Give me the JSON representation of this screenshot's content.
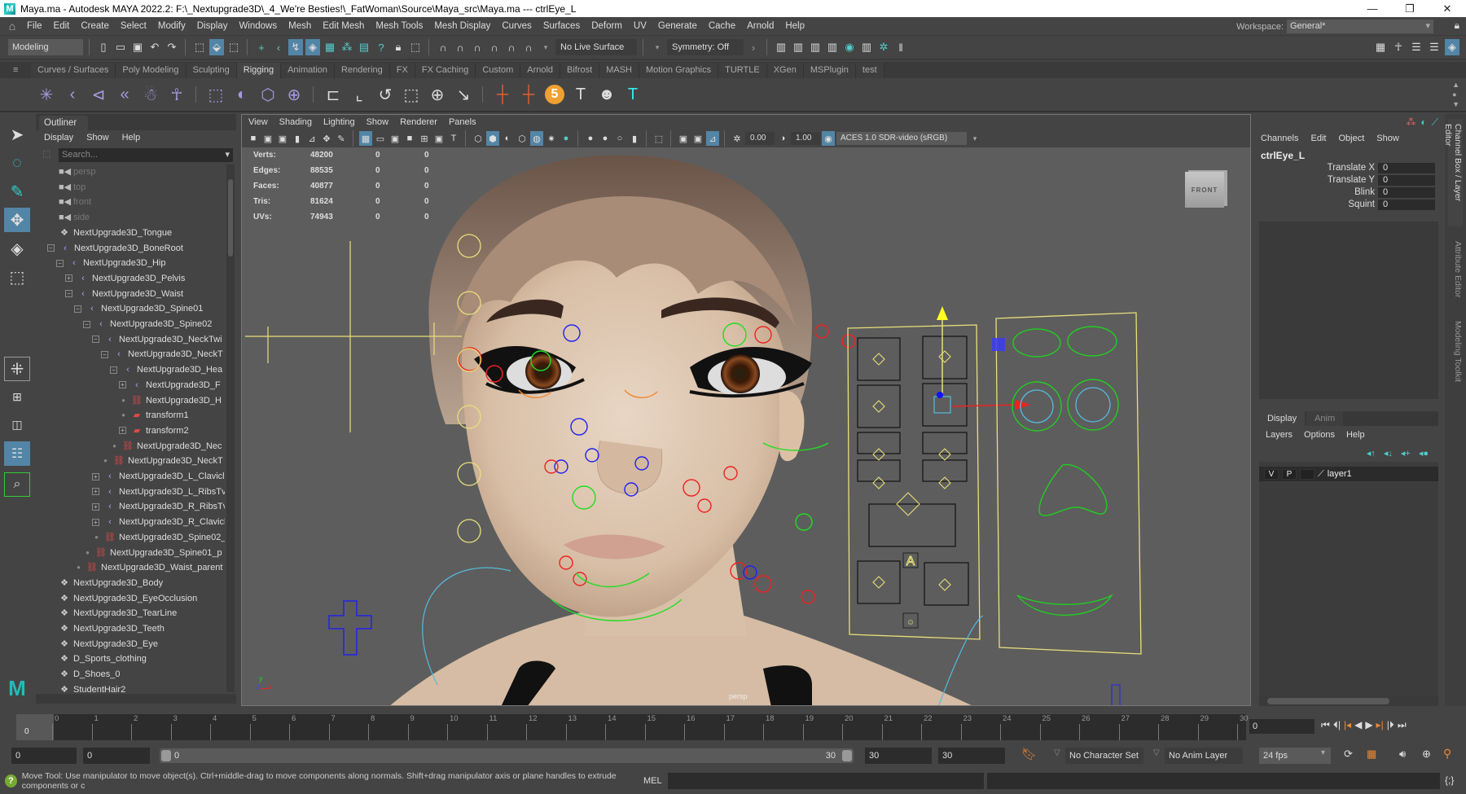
{
  "window": {
    "title": "Maya.ma - Autodesk MAYA 2022.2: F:\\_Nextupgrade3D\\_4_We're Besties!\\_FatWoman\\Source\\Maya_src\\Maya.ma  ---  ctrlEye_L",
    "minimize": "—",
    "restore": "❐",
    "close": "✕"
  },
  "menubar": {
    "items": [
      "File",
      "Edit",
      "Create",
      "Select",
      "Modify",
      "Display",
      "Windows",
      "Mesh",
      "Edit Mesh",
      "Mesh Tools",
      "Mesh Display",
      "Curves",
      "Surfaces",
      "Deform",
      "UV",
      "Generate",
      "Cache",
      "Arnold",
      "Help"
    ],
    "workspace_label": "Workspace:",
    "workspace_value": "General*"
  },
  "statusline": {
    "menuset": "Modeling",
    "live_surface": "No Live Surface",
    "symmetry": "Symmetry: Off"
  },
  "shelf": {
    "tabs": [
      "Curves / Surfaces",
      "Poly Modeling",
      "Sculpting",
      "Rigging",
      "Animation",
      "Rendering",
      "FX",
      "FX Caching",
      "Custom",
      "Arnold",
      "Bifrost",
      "MASH",
      "Motion Graphics",
      "TURTLE",
      "XGen",
      "MSPlugin",
      "test"
    ],
    "active_tab": "Rigging",
    "badge_number": "5"
  },
  "outliner": {
    "tab": "Outliner",
    "menu": [
      "Display",
      "Show",
      "Help"
    ],
    "search_placeholder": "Search...",
    "items": [
      {
        "label": "persp",
        "type": "camera",
        "depth": 0,
        "dim": true
      },
      {
        "label": "top",
        "type": "camera",
        "depth": 0,
        "dim": true
      },
      {
        "label": "front",
        "type": "camera",
        "depth": 0,
        "dim": true
      },
      {
        "label": "side",
        "type": "camera",
        "depth": 0,
        "dim": true
      },
      {
        "label": "NextUpgrade3D_Tongue",
        "type": "mesh",
        "depth": 0
      },
      {
        "label": "NextUpgrade3D_BoneRoot",
        "type": "joint",
        "depth": 0,
        "expand": "minus"
      },
      {
        "label": "NextUpgrade3D_Hip",
        "type": "joint",
        "depth": 1,
        "expand": "minus"
      },
      {
        "label": "NextUpgrade3D_Pelvis",
        "type": "joint",
        "depth": 2,
        "expand": "plus"
      },
      {
        "label": "NextUpgrade3D_Waist",
        "type": "joint",
        "depth": 2,
        "expand": "minus"
      },
      {
        "label": "NextUpgrade3D_Spine01",
        "type": "joint",
        "depth": 3,
        "expand": "minus"
      },
      {
        "label": "NextUpgrade3D_Spine02",
        "type": "joint",
        "depth": 4,
        "expand": "minus"
      },
      {
        "label": "NextUpgrade3D_NeckTwi",
        "type": "joint",
        "depth": 5,
        "expand": "minus"
      },
      {
        "label": "NextUpgrade3D_NeckT",
        "type": "joint",
        "depth": 6,
        "expand": "minus"
      },
      {
        "label": "NextUpgrade3D_Hea",
        "type": "joint",
        "depth": 7,
        "expand": "minus"
      },
      {
        "label": "NextUpgrade3D_F",
        "type": "joint",
        "depth": 8,
        "expand": "plus"
      },
      {
        "label": "NextUpgrade3D_H",
        "type": "constraint",
        "depth": 8
      },
      {
        "label": "transform1",
        "type": "transform",
        "depth": 8
      },
      {
        "label": "transform2",
        "type": "transform",
        "depth": 8,
        "expand": "plus"
      },
      {
        "label": "NextUpgrade3D_Nec",
        "type": "constraint",
        "depth": 7
      },
      {
        "label": "NextUpgrade3D_NeckT",
        "type": "constraint",
        "depth": 6
      },
      {
        "label": "NextUpgrade3D_L_Clavicl",
        "type": "joint",
        "depth": 5,
        "expand": "plus"
      },
      {
        "label": "NextUpgrade3D_L_RibsTv",
        "type": "joint",
        "depth": 5,
        "expand": "plus"
      },
      {
        "label": "NextUpgrade3D_R_RibsTv",
        "type": "joint",
        "depth": 5,
        "expand": "plus"
      },
      {
        "label": "NextUpgrade3D_R_Clavicl",
        "type": "joint",
        "depth": 5,
        "expand": "plus"
      },
      {
        "label": "NextUpgrade3D_Spine02_",
        "type": "constraint",
        "depth": 5
      },
      {
        "label": "NextUpgrade3D_Spine01_p",
        "type": "constraint",
        "depth": 4
      },
      {
        "label": "NextUpgrade3D_Waist_parent",
        "type": "constraint",
        "depth": 3
      },
      {
        "label": "NextUpgrade3D_Body",
        "type": "mesh",
        "depth": 0
      },
      {
        "label": "NextUpgrade3D_EyeOcclusion",
        "type": "mesh",
        "depth": 0
      },
      {
        "label": "NextUpgrade3D_TearLine",
        "type": "mesh",
        "depth": 0
      },
      {
        "label": "NextUpgrade3D_Teeth",
        "type": "mesh",
        "depth": 0
      },
      {
        "label": "NextUpgrade3D_Eye",
        "type": "mesh",
        "depth": 0
      },
      {
        "label": "D_Sports_clothing",
        "type": "mesh",
        "depth": 0
      },
      {
        "label": "D_Shoes_0",
        "type": "mesh",
        "depth": 0
      },
      {
        "label": "StudentHair2",
        "type": "mesh",
        "depth": 0
      }
    ]
  },
  "viewport": {
    "menu": [
      "View",
      "Shading",
      "Lighting",
      "Show",
      "Renderer",
      "Panels"
    ],
    "exposure": "0.00",
    "gamma": "1.00",
    "color_space": "ACES 1.0 SDR-video (sRGB)",
    "hud": [
      {
        "label": "Verts:",
        "v1": "48200",
        "v2": "0",
        "v3": "0"
      },
      {
        "label": "Edges:",
        "v1": "88535",
        "v2": "0",
        "v3": "0"
      },
      {
        "label": "Faces:",
        "v1": "40877",
        "v2": "0",
        "v3": "0"
      },
      {
        "label": "Tris:",
        "v1": "81624",
        "v2": "0",
        "v3": "0"
      },
      {
        "label": "UVs:",
        "v1": "74943",
        "v2": "0",
        "v3": "0"
      }
    ],
    "viewcube": "FRONT",
    "camera": "persp",
    "axis_x": "x",
    "axis_y": "y",
    "axis_z": "z"
  },
  "channelbox": {
    "menu": [
      "Channels",
      "Edit",
      "Object",
      "Show"
    ],
    "object": "ctrlEye_L",
    "attributes": [
      {
        "name": "Translate X",
        "value": "0"
      },
      {
        "name": "Translate Y",
        "value": "0"
      },
      {
        "name": "Blink",
        "value": "0"
      },
      {
        "name": "Squint",
        "value": "0"
      }
    ]
  },
  "layereditor": {
    "tabs": [
      "Display",
      "Anim"
    ],
    "menu": [
      "Layers",
      "Options",
      "Help"
    ],
    "layer": {
      "v": "V",
      "p": "P",
      "name": "layer1"
    }
  },
  "side_tabs": [
    "Channel Box / Layer Editor",
    "Attribute Editor",
    "Modeling Toolkit"
  ],
  "timeline": {
    "ticks": [
      "0",
      "1",
      "2",
      "3",
      "4",
      "5",
      "6",
      "7",
      "8",
      "9",
      "10",
      "11",
      "12",
      "13",
      "14",
      "15",
      "16",
      "17",
      "18",
      "19",
      "20",
      "21",
      "22",
      "23",
      "24",
      "25",
      "26",
      "27",
      "28",
      "29",
      "30"
    ],
    "current_frame_marker": "0",
    "current_frame": "0"
  },
  "range": {
    "start": "0",
    "anim_start": "0",
    "slider_start": "0",
    "slider_end": "30",
    "anim_end": "30",
    "end": "30",
    "character_set": "No Character Set",
    "anim_layer": "No Anim Layer",
    "fps": "24 fps"
  },
  "helpline": {
    "text": "Move Tool: Use manipulator to move object(s). Ctrl+middle-drag to move components along normals. Shift+drag manipulator axis or plane handles to extrude components or c",
    "mel_label": "MEL"
  }
}
